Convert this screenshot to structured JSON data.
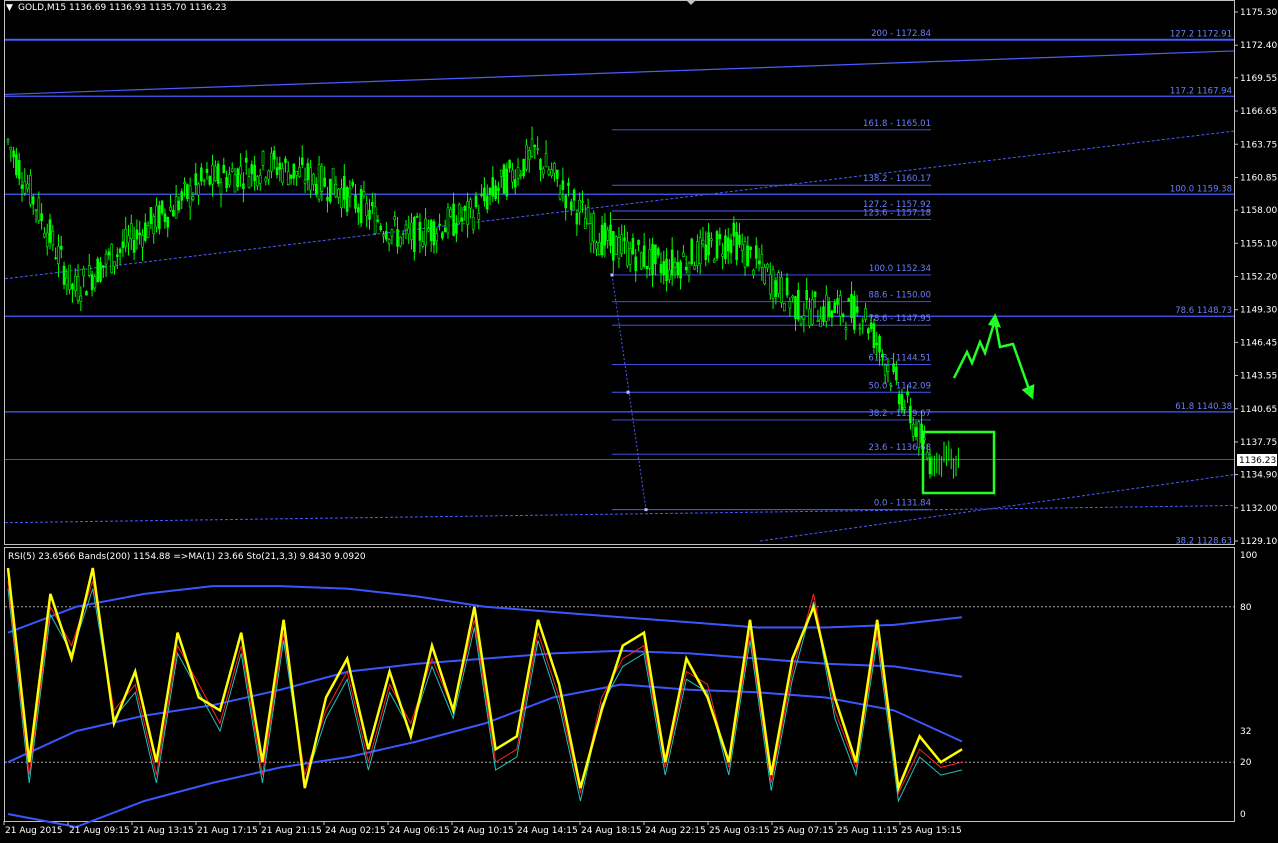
{
  "window": {
    "title": "GOLD,M15",
    "ohlc": "1136.69 1136.93 1135.70 1136.23",
    "bid_price_tag": "1136.23"
  },
  "price_axis": {
    "ticks": [
      "1175.30",
      "1172.40",
      "1169.55",
      "1166.65",
      "1163.75",
      "1160.85",
      "1158.00",
      "1155.10",
      "1152.20",
      "1149.30",
      "1146.45",
      "1143.55",
      "1140.65",
      "1137.75",
      "1134.90",
      "1132.00",
      "1129.10"
    ]
  },
  "indicator_axis": {
    "ticks": [
      "100",
      "80",
      "32",
      "20",
      "0"
    ]
  },
  "indicator_header": "RSI(5) 23.6566  Bands(200) 1154.88  =>MA(1) 23.66  Sto(21,3,3) 9.8430 9.0920",
  "time_axis": {
    "ticks": [
      "21 Aug 2015",
      "21 Aug 09:15",
      "21 Aug 13:15",
      "21 Aug 17:15",
      "21 Aug 21:15",
      "24 Aug 02:15",
      "24 Aug 06:15",
      "24 Aug 10:15",
      "24 Aug 14:15",
      "24 Aug 18:15",
      "24 Aug 22:15",
      "25 Aug 03:15",
      "25 Aug 07:15",
      "25 Aug 11:15",
      "25 Aug 15:15"
    ]
  },
  "fib_labels_left": [
    {
      "text": "200 - 1172.84",
      "price": 1172.84
    },
    {
      "text": "161.8 - 1165.01",
      "price": 1165.01
    },
    {
      "text": "138.2 - 1160.17",
      "price": 1160.17
    },
    {
      "text": "127.2 - 1157.92",
      "price": 1157.92
    },
    {
      "text": "123.6 - 1157.18",
      "price": 1157.18
    },
    {
      "text": "100.0  1152.34",
      "price": 1152.34
    },
    {
      "text": "88.6 - 1150.00",
      "price": 1150.0
    },
    {
      "text": "78.6 - 1147.95",
      "price": 1147.95
    },
    {
      "text": "61.8 - 1144.51",
      "price": 1144.51
    },
    {
      "text": "50.0 - 1142.09",
      "price": 1142.09
    },
    {
      "text": "38.2 - 1139.67",
      "price": 1139.67
    },
    {
      "text": "23.6 - 1136.68",
      "price": 1136.68
    },
    {
      "text": "0.0 - 1131.84",
      "price": 1131.84
    }
  ],
  "fib_labels_right": [
    {
      "text": "127.2  1172.91",
      "price": 1172.91
    },
    {
      "text": "117.2  1167.94",
      "price": 1167.94
    },
    {
      "text": "100.0  1159.38",
      "price": 1159.38
    },
    {
      "text": "78.6  1148.73",
      "price": 1148.73
    },
    {
      "text": "61.8  1140.38",
      "price": 1140.38
    },
    {
      "text": "38.2  1128.63",
      "price": 1128.63
    }
  ],
  "colors": {
    "background": "#000000",
    "candles": "#00ff00",
    "levels": "#4a5cff",
    "rsi": "#ffff00",
    "stoch_main": "#ff2020",
    "stoch_signal": "#20c0c0",
    "bands": "#3a56ff",
    "annotation": "#22ff22"
  },
  "chart_data": {
    "type": "line",
    "symbol": "GOLD",
    "timeframe": "M15",
    "ylim": [
      1128.0,
      1176.5
    ],
    "price_series": {
      "name": "GOLD,M15",
      "x": [
        "21 Aug 2015",
        "21 Aug 09:15",
        "21 Aug 13:15",
        "21 Aug 17:15",
        "21 Aug 21:15",
        "24 Aug 02:15",
        "24 Aug 06:15",
        "24 Aug 10:15",
        "24 Aug 14:15",
        "24 Aug 18:15",
        "24 Aug 22:15",
        "25 Aug 03:15",
        "25 Aug 07:15",
        "25 Aug 11:15",
        "25 Aug 15:15"
      ],
      "y": [
        1164.0,
        1151.0,
        1156.0,
        1160.5,
        1162.0,
        1160.0,
        1155.5,
        1157.5,
        1163.0,
        1155.5,
        1153.0,
        1155.5,
        1149.5,
        1149.0,
        1136.2
      ]
    },
    "last_close": 1136.23,
    "indicator": {
      "ylim": [
        0,
        100
      ],
      "levels": [
        80,
        20
      ],
      "rsi": [
        95,
        20,
        85,
        60,
        95,
        35,
        55,
        20,
        70,
        45,
        40,
        70,
        20,
        75,
        10,
        45,
        60,
        25,
        55,
        30,
        65,
        40,
        80,
        25,
        30,
        75,
        50,
        10,
        40,
        65,
        70,
        20,
        60,
        45,
        20,
        75,
        15,
        60,
        80,
        45,
        20,
        75,
        10,
        30,
        20,
        25
      ],
      "stoch": [
        90,
        15,
        80,
        65,
        90,
        40,
        50,
        15,
        65,
        50,
        35,
        65,
        15,
        70,
        15,
        40,
        55,
        20,
        50,
        35,
        60,
        40,
        75,
        20,
        25,
        70,
        45,
        8,
        45,
        60,
        65,
        18,
        55,
        50,
        18,
        70,
        12,
        55,
        85,
        40,
        18,
        70,
        8,
        25,
        18,
        20
      ],
      "bands_upper": [
        70,
        80,
        85,
        88,
        88,
        87,
        84,
        80,
        78,
        76,
        74,
        72,
        72,
        73,
        76
      ],
      "bands_mid": [
        20,
        32,
        38,
        42,
        48,
        55,
        58,
        60,
        62,
        63,
        62,
        60,
        58,
        57,
        53
      ],
      "bands_lower": [
        0,
        -5,
        5,
        12,
        18,
        22,
        28,
        35,
        45,
        50,
        48,
        47,
        45,
        40,
        28
      ]
    }
  }
}
